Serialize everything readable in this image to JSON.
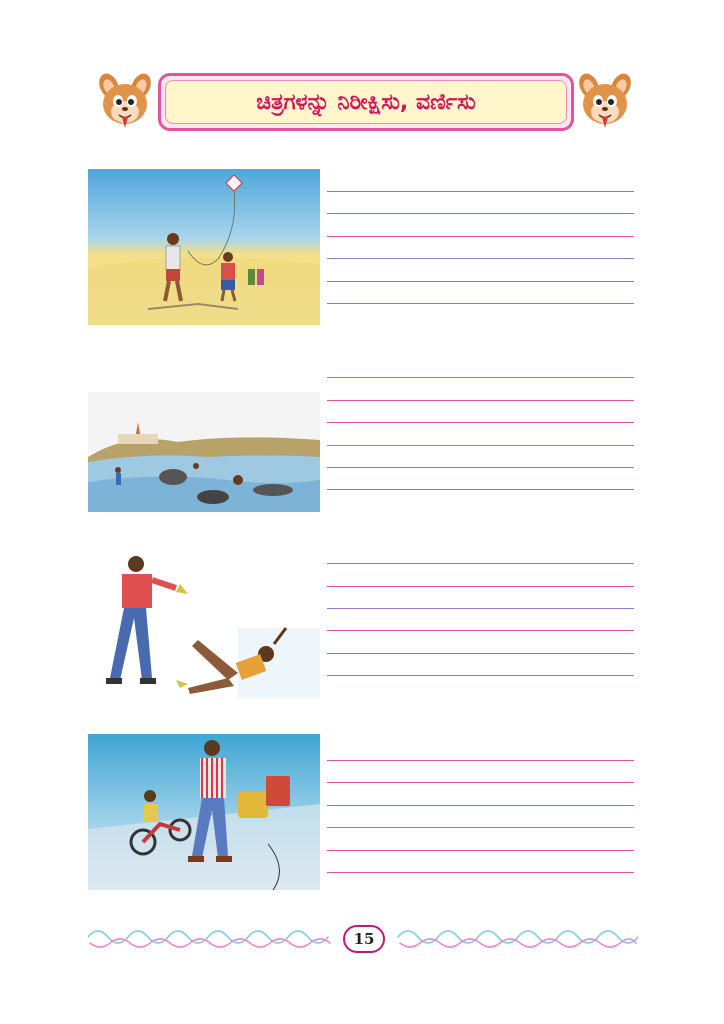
{
  "header": {
    "title": "ಚಿತ್ರಗಳನ್ನು ನಿರೀಕ್ಷಿಸು, ವರ್ಣಿಸು",
    "mascot_left_icon": "chipmunk-mascot-icon",
    "mascot_right_icon": "chipmunk-mascot-icon"
  },
  "exercises": [
    {
      "illustration": "kite-flying-beach-scene",
      "writing_lines": 6
    },
    {
      "illustration": "river-bathing-buffaloes-scene",
      "writing_lines": 6
    },
    {
      "illustration": "man-slipping-on-banana-peel-scene",
      "writing_lines": 6
    },
    {
      "illustration": "man-on-phone-crossing-road-scene",
      "writing_lines": 6
    }
  ],
  "footer": {
    "page_number": "15",
    "ornament": "wave-scroll-border"
  },
  "colors": {
    "accent_pink": "#e0559e",
    "title_text": "#d4145a",
    "title_fill": "#fff6cc",
    "ornament_blue": "#7fc8e8",
    "ornament_pink": "#f08cc0"
  }
}
